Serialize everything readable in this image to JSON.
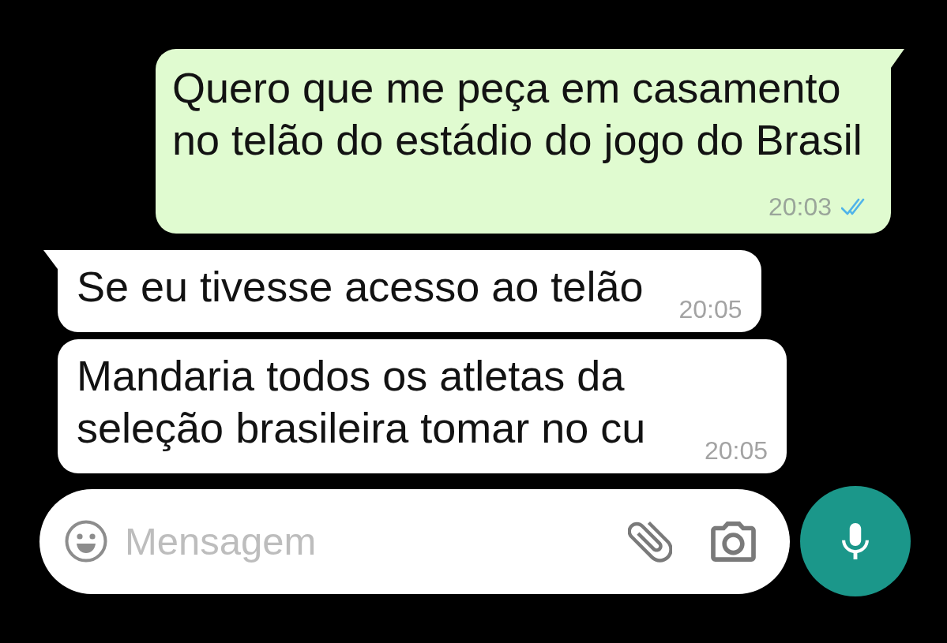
{
  "messages": [
    {
      "kind": "outgoing",
      "text": "Quero que me peça em casamento no telão do estádio do jogo do Brasil",
      "time": "20:03",
      "read": true,
      "tail": true
    },
    {
      "kind": "incoming",
      "text": "Se eu tivesse acesso ao telão",
      "time": "20:05",
      "tail": true
    },
    {
      "kind": "incoming",
      "text": "Mandaria todos os atletas da seleção brasileira tomar no cu",
      "time": "20:05",
      "tail": false
    }
  ],
  "composer": {
    "placeholder": "Mensagem"
  }
}
